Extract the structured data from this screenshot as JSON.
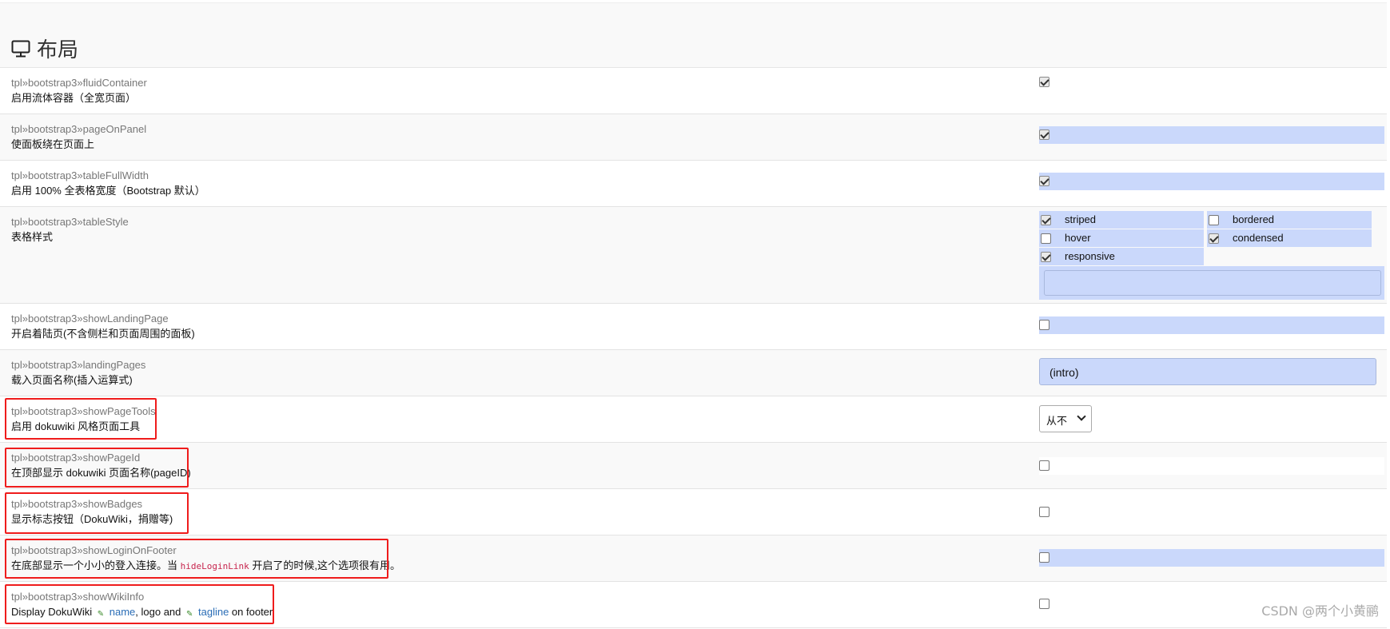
{
  "section": {
    "title": "布局",
    "icon": "monitor-icon"
  },
  "settings": [
    {
      "key": "tpl»bootstrap3»fluidContainer",
      "desc": "启用流体容器（全宽页面）",
      "checked": true
    },
    {
      "key": "tpl»bootstrap3»pageOnPanel",
      "desc": "使面板绕在页面上",
      "checked": true
    },
    {
      "key": "tpl»bootstrap3»tableFullWidth",
      "desc": "启用 100% 全表格宽度（Bootstrap 默认）",
      "checked": true
    },
    {
      "key": "tpl»bootstrap3»tableStyle",
      "desc": "表格样式",
      "options": [
        {
          "label": "striped",
          "checked": true
        },
        {
          "label": "bordered",
          "checked": false
        },
        {
          "label": "hover",
          "checked": false
        },
        {
          "label": "condensed",
          "checked": true
        },
        {
          "label": "responsive",
          "checked": true
        }
      ],
      "extra_value": ""
    },
    {
      "key": "tpl»bootstrap3»showLandingPage",
      "desc": "开启着陆页(不含侧栏和页面周围的面板)",
      "checked": false
    },
    {
      "key": "tpl»bootstrap3»landingPages",
      "desc": "载入页面名称(插入运算式)",
      "value": "(intro)"
    },
    {
      "key": "tpl»bootstrap3»showPageTools",
      "desc": "启用 dokuwiki 风格页面工具",
      "select_value": "从不"
    },
    {
      "key": "tpl»bootstrap3»showPageId",
      "desc": "在顶部显示 dokuwiki 页面名称(pageID)",
      "checked": false
    },
    {
      "key": "tpl»bootstrap3»showBadges",
      "desc": "显示标志按钮（DokuWiki，捐赠等)",
      "checked": false
    },
    {
      "key": "tpl»bootstrap3»showLoginOnFooter",
      "desc_before": "在底部显示一个小小的登入连接。当 ",
      "desc_code": "hideLoginLink",
      "desc_after": " 开启了的时候,这个选项很有用。",
      "checked": false
    },
    {
      "key": "tpl»bootstrap3»showWikiInfo",
      "desc_before": "Display DokuWiki ",
      "link1": "name",
      "desc_mid": ", logo and ",
      "link2": "tagline",
      "desc_after": " on footer",
      "checked": false
    }
  ],
  "watermark": "CSDN @两个小黄鹂",
  "colors": {
    "highlight": "#cad8fb",
    "annotation": "#ef1c1c"
  }
}
